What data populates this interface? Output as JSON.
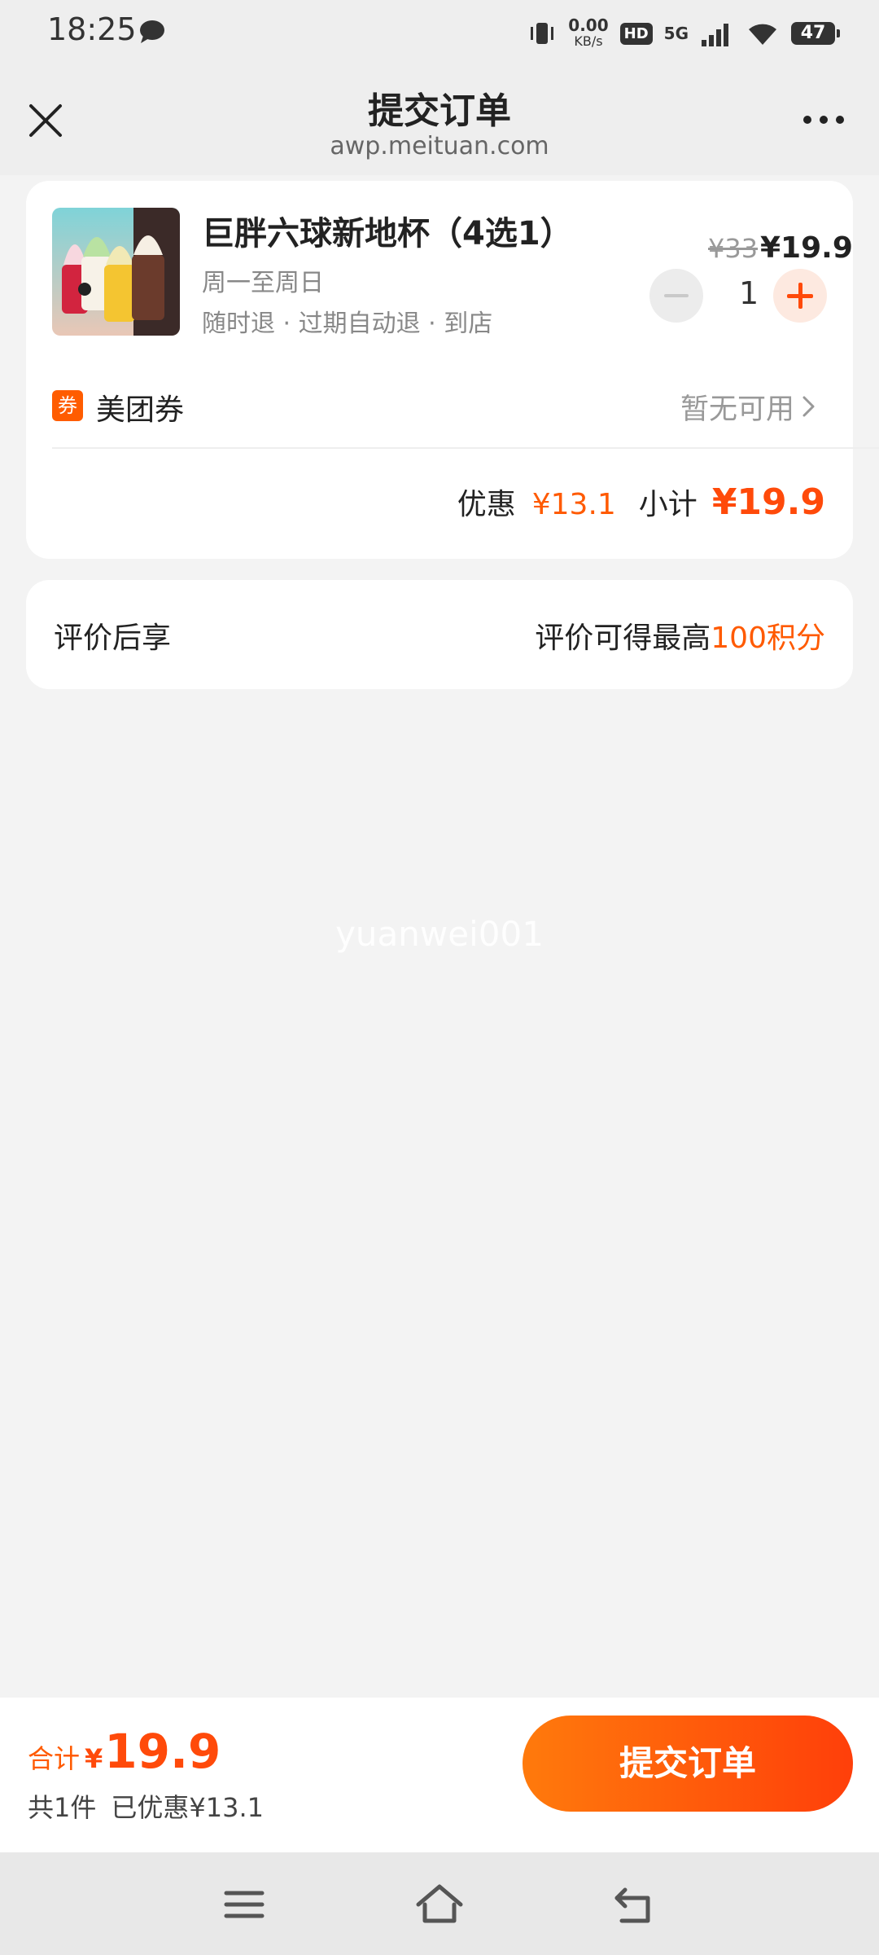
{
  "status_bar": {
    "time": "18:25",
    "net_speed_value": "0.00",
    "net_speed_unit": "KB/s",
    "hd_label": "HD",
    "network_label": "5G",
    "battery": "47",
    "icons": [
      "message-icon",
      "vibrate-icon",
      "signal-icon",
      "wifi-icon",
      "battery-icon"
    ]
  },
  "nav": {
    "title": "提交订单",
    "url": "awp.meituan.com",
    "icons": [
      "close-icon",
      "more-icon"
    ]
  },
  "product": {
    "name": "巨胖六球新地杯（4选1）",
    "days": "周一至周日",
    "tags": "随时退 · 过期自动退 · 到店",
    "original_price": "¥33",
    "price": "¥19.9",
    "quantity": "1"
  },
  "coupon": {
    "badge": "券",
    "label": "美团券",
    "status": "暂无可用"
  },
  "summary": {
    "discount_label": "优惠",
    "discount_value": "¥13.1",
    "subtotal_label": "小计",
    "subtotal_value": "¥19.9"
  },
  "review": {
    "label": "评价后享",
    "text_prefix": "评价可得最高",
    "text_highlight": "100积分"
  },
  "watermark": "yuanwei001",
  "bottom": {
    "total_label": "合计",
    "currency": "¥",
    "total_amount": "19.9",
    "count_text": "共1件",
    "saved_text": "已优惠¥13.1",
    "submit_label": "提交订单"
  },
  "colors": {
    "accent": "#ff4a0a",
    "accent_light": "#ff7a0c",
    "background": "#f3f3f3"
  }
}
